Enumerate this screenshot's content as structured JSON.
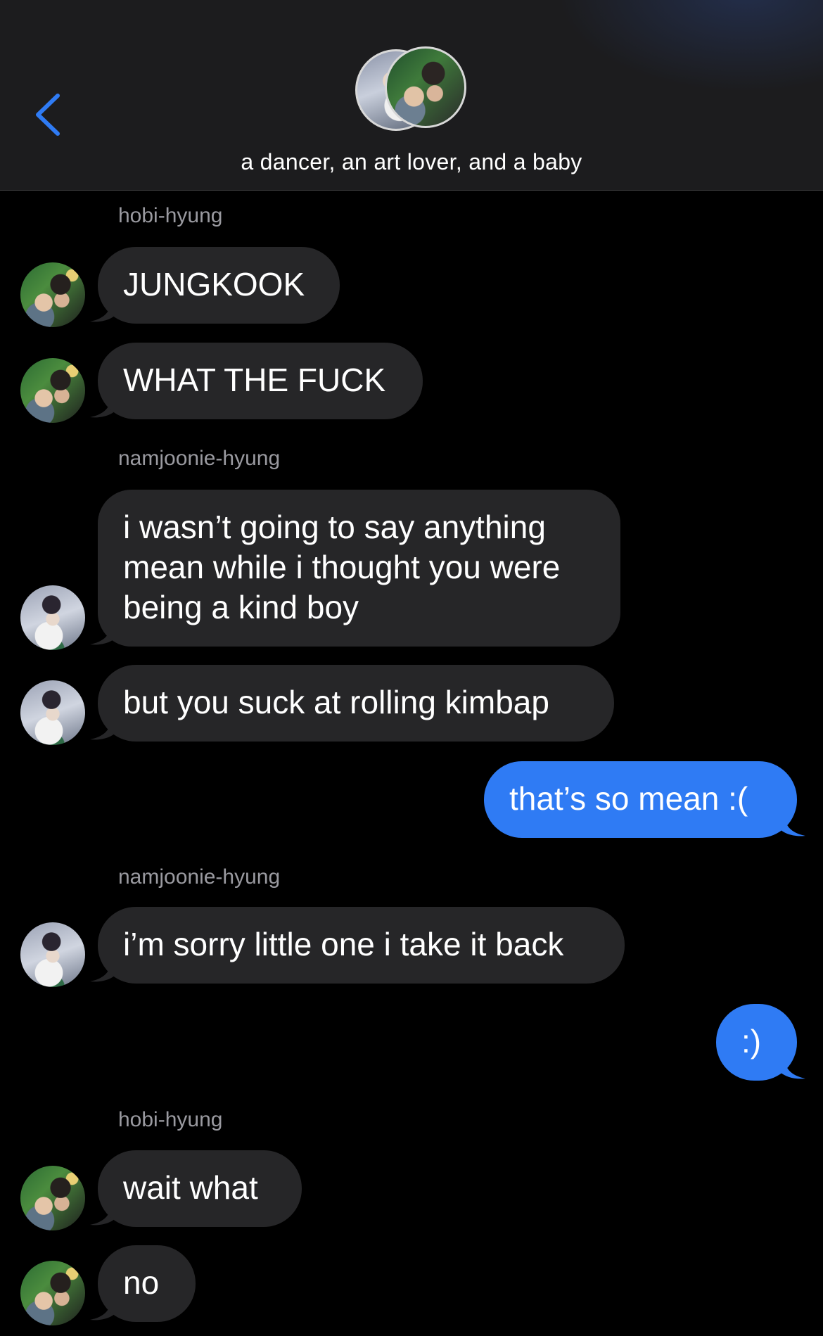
{
  "header": {
    "title": "a dancer, an art lover, and a baby",
    "back_icon": "chevron-left-icon",
    "accent": "#2f7bf4"
  },
  "messages": [
    {
      "type": "label",
      "text": "hobi-hyung"
    },
    {
      "type": "in",
      "sender": "hobi-hyung",
      "text": "JUNGKOOK"
    },
    {
      "type": "in",
      "sender": "hobi-hyung",
      "text": "WHAT THE FUCK"
    },
    {
      "type": "label",
      "text": "namjoonie-hyung"
    },
    {
      "type": "in",
      "sender": "namjoonie-hyung",
      "lines": [
        "i wasn’t going to say anything",
        "mean while i thought you were",
        "being a kind boy"
      ]
    },
    {
      "type": "in",
      "sender": "namjoonie-hyung",
      "text": "but you suck at rolling kimbap"
    },
    {
      "type": "out",
      "text": "that’s so mean :("
    },
    {
      "type": "label",
      "text": "namjoonie-hyung"
    },
    {
      "type": "in",
      "sender": "namjoonie-hyung",
      "text": "i’m sorry little one i take it back"
    },
    {
      "type": "out",
      "text": ":)"
    },
    {
      "type": "label",
      "text": "hobi-hyung"
    },
    {
      "type": "in",
      "sender": "hobi-hyung",
      "text": "wait what"
    },
    {
      "type": "in",
      "sender": "hobi-hyung",
      "text": "no"
    }
  ],
  "colors": {
    "incoming_bubble": "#262628",
    "outgoing_bubble": "#2f7bf4",
    "sender_label": "#9a9aa0"
  }
}
